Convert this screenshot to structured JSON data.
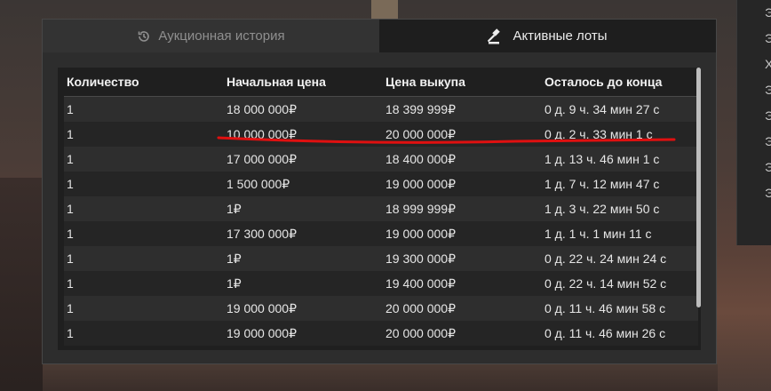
{
  "tabs": [
    {
      "label": "Аукционная история",
      "icon": "history-icon",
      "active": false
    },
    {
      "label": "Активные лоты",
      "icon": "gavel-icon",
      "active": true
    }
  ],
  "table": {
    "columns": [
      "Количество",
      "Начальная цена",
      "Цена выкупа",
      "Осталось до конца"
    ],
    "rows": [
      [
        "1",
        "18 000 000₽",
        "18 399 999₽",
        "0 д. 9 ч. 34 мин 27 с"
      ],
      [
        "1",
        "10 000 000₽",
        "20 000 000₽",
        "0 д. 2 ч. 33 мин 1 с"
      ],
      [
        "1",
        "17 000 000₽",
        "18 400 000₽",
        "1 д. 13 ч. 46 мин 1 с"
      ],
      [
        "1",
        "1 500 000₽",
        "19 000 000₽",
        "1 д. 7 ч. 12 мин 47 с"
      ],
      [
        "1",
        "1₽",
        "18 999 999₽",
        "1 д. 3 ч. 22 мин 50 с"
      ],
      [
        "1",
        "17 300 000₽",
        "19 000 000₽",
        "1 д. 1 ч. 1 мин 11 с"
      ],
      [
        "1",
        "1₽",
        "19 300 000₽",
        "0 д. 22 ч. 24 мин 24 с"
      ],
      [
        "1",
        "1₽",
        "19 400 000₽",
        "0 д. 22 ч. 14 мин 52 с"
      ],
      [
        "1",
        "19 000 000₽",
        "20 000 000₽",
        "0 д. 11 ч. 46 мин 58 с"
      ],
      [
        "1",
        "19 000 000₽",
        "20 000 000₽",
        "0 д. 11 ч. 46 мин 26 с"
      ]
    ]
  },
  "side_panel": {
    "items": [
      "Э",
      "Э",
      "Х",
      "Э",
      "Э",
      "Э",
      "Э",
      "Э"
    ]
  },
  "annotation": {
    "color": "#e01010"
  }
}
